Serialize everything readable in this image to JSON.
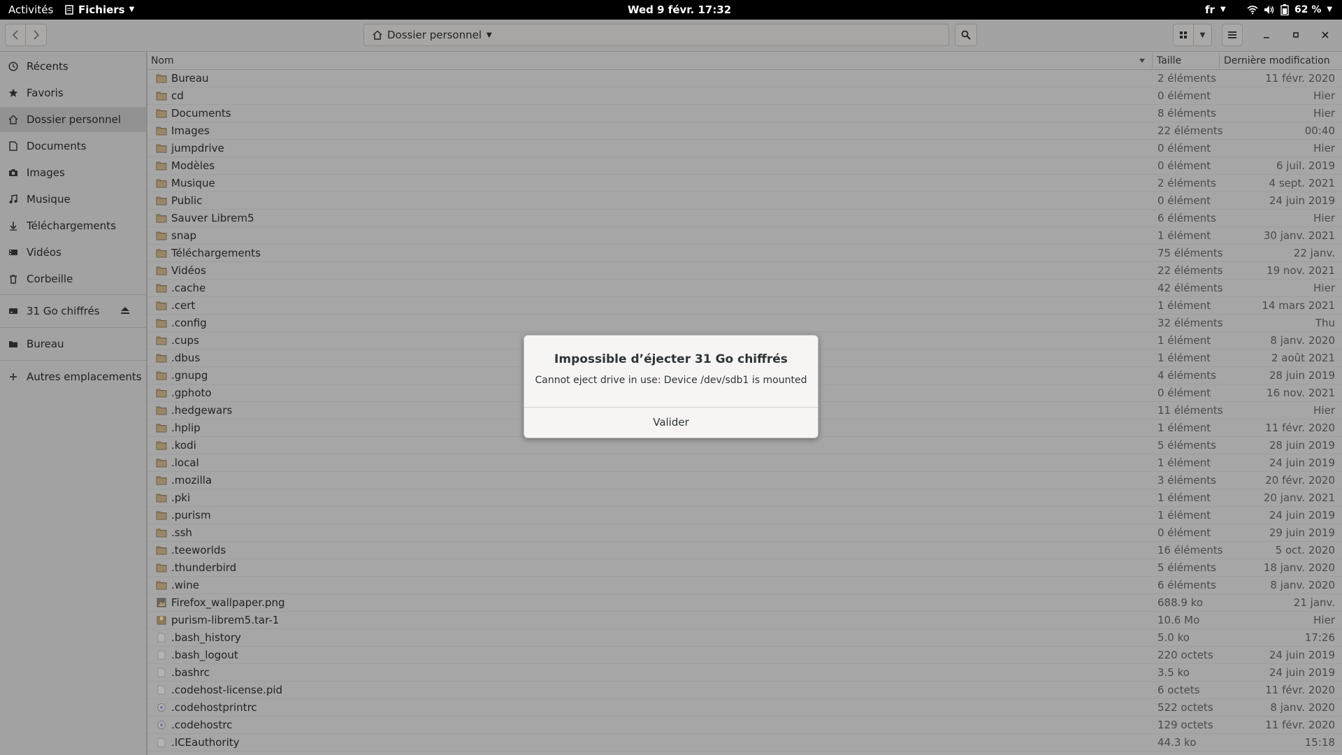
{
  "topbar": {
    "activities": "Activités",
    "app_menu": "Fichiers",
    "clock": "Wed 9 févr.  17:32",
    "language": "fr",
    "battery": "62 %"
  },
  "headerbar": {
    "location": "Dossier personnel"
  },
  "sidebar": {
    "items": [
      {
        "label": "Récents",
        "icon": "clock-icon"
      },
      {
        "label": "Favoris",
        "icon": "star-icon"
      },
      {
        "label": "Dossier personnel",
        "icon": "home-icon"
      },
      {
        "label": "Documents",
        "icon": "document-icon"
      },
      {
        "label": "Images",
        "icon": "camera-icon"
      },
      {
        "label": "Musique",
        "icon": "music-icon"
      },
      {
        "label": "Téléchargements",
        "icon": "download-icon"
      },
      {
        "label": "Vidéos",
        "icon": "video-icon"
      },
      {
        "label": "Corbeille",
        "icon": "trash-icon"
      }
    ],
    "drive": {
      "label": "31 Go chiffrés",
      "icon": "drive-icon"
    },
    "bookmark": {
      "label": "Bureau",
      "icon": "folder-icon"
    },
    "other": {
      "label": "Autres emplacements",
      "icon": "plus-icon"
    }
  },
  "columns": {
    "name": "Nom",
    "size": "Taille",
    "modified": "Dernière modification"
  },
  "files": [
    {
      "name": "Bureau",
      "size": "2 éléments",
      "modified": "11 févr. 2020",
      "type": "folder"
    },
    {
      "name": "cd",
      "size": "0 élément",
      "modified": "Hier",
      "type": "folder"
    },
    {
      "name": "Documents",
      "size": "8 éléments",
      "modified": "Hier",
      "type": "folder"
    },
    {
      "name": "Images",
      "size": "22 éléments",
      "modified": "00:40",
      "type": "folder"
    },
    {
      "name": "jumpdrive",
      "size": "0 élément",
      "modified": "Hier",
      "type": "folder"
    },
    {
      "name": "Modèles",
      "size": "0 élément",
      "modified": "6 juil. 2019",
      "type": "folder"
    },
    {
      "name": "Musique",
      "size": "2 éléments",
      "modified": "4 sept. 2021",
      "type": "folder"
    },
    {
      "name": "Public",
      "size": "0 élément",
      "modified": "24 juin 2019",
      "type": "folder"
    },
    {
      "name": "Sauver Librem5",
      "size": "6 éléments",
      "modified": "Hier",
      "type": "folder"
    },
    {
      "name": "snap",
      "size": "1 élément",
      "modified": "30 janv. 2021",
      "type": "folder"
    },
    {
      "name": "Téléchargements",
      "size": "75 éléments",
      "modified": "22 janv.",
      "type": "folder"
    },
    {
      "name": "Vidéos",
      "size": "22 éléments",
      "modified": "19 nov. 2021",
      "type": "folder"
    },
    {
      "name": ".cache",
      "size": "42 éléments",
      "modified": "Hier",
      "type": "folder"
    },
    {
      "name": ".cert",
      "size": "1 élément",
      "modified": "14 mars 2021",
      "type": "folder"
    },
    {
      "name": ".config",
      "size": "32 éléments",
      "modified": "Thu",
      "type": "folder"
    },
    {
      "name": ".cups",
      "size": "1 élément",
      "modified": "8 janv. 2020",
      "type": "folder"
    },
    {
      "name": ".dbus",
      "size": "1 élément",
      "modified": "2 août 2021",
      "type": "folder"
    },
    {
      "name": ".gnupg",
      "size": "4 éléments",
      "modified": "28 juin 2019",
      "type": "folder"
    },
    {
      "name": ".gphoto",
      "size": "0 élément",
      "modified": "16 nov. 2021",
      "type": "folder"
    },
    {
      "name": ".hedgewars",
      "size": "11 éléments",
      "modified": "Hier",
      "type": "folder"
    },
    {
      "name": ".hplip",
      "size": "1 élément",
      "modified": "11 févr. 2020",
      "type": "folder"
    },
    {
      "name": ".kodi",
      "size": "5 éléments",
      "modified": "28 juin 2019",
      "type": "folder"
    },
    {
      "name": ".local",
      "size": "1 élément",
      "modified": "24 juin 2019",
      "type": "folder"
    },
    {
      "name": ".mozilla",
      "size": "3 éléments",
      "modified": "20 févr. 2020",
      "type": "folder"
    },
    {
      "name": ".pki",
      "size": "1 élément",
      "modified": "20 janv. 2021",
      "type": "folder"
    },
    {
      "name": ".purism",
      "size": "1 élément",
      "modified": "24 juin 2019",
      "type": "folder"
    },
    {
      "name": ".ssh",
      "size": "0 élément",
      "modified": "29 juin 2019",
      "type": "folder"
    },
    {
      "name": ".teeworlds",
      "size": "16 éléments",
      "modified": "5 oct. 2020",
      "type": "folder"
    },
    {
      "name": ".thunderbird",
      "size": "5 éléments",
      "modified": "18 janv. 2020",
      "type": "folder"
    },
    {
      "name": ".wine",
      "size": "6 éléments",
      "modified": "8 janv. 2020",
      "type": "folder"
    },
    {
      "name": "Firefox_wallpaper.png",
      "size": "688.9 ko",
      "modified": "21 janv.",
      "type": "image"
    },
    {
      "name": "purism-librem5.tar-1",
      "size": "10.6 Mo",
      "modified": "Hier",
      "type": "archive"
    },
    {
      "name": ".bash_history",
      "size": "5.0 ko",
      "modified": "17:26",
      "type": "text"
    },
    {
      "name": ".bash_logout",
      "size": "220 octets",
      "modified": "24 juin 2019",
      "type": "text"
    },
    {
      "name": ".bashrc",
      "size": "3.5 ko",
      "modified": "24 juin 2019",
      "type": "text"
    },
    {
      "name": ".codehost-license.pid",
      "size": "6 octets",
      "modified": "11 févr. 2020",
      "type": "text"
    },
    {
      "name": ".codehostprintrc",
      "size": "522 octets",
      "modified": "8 janv. 2020",
      "type": "config"
    },
    {
      "name": ".codehostrc",
      "size": "129 octets",
      "modified": "11 févr. 2020",
      "type": "config"
    },
    {
      "name": ".ICEauthority",
      "size": "44.3 ko",
      "modified": "15:18",
      "type": "text"
    }
  ],
  "dialog": {
    "title": "Impossible d’éjecter 31 Go chiffrés",
    "message": "Cannot eject drive in use: Device /dev/sdb1 is mounted",
    "button": "Valider"
  },
  "colors": {
    "folder": "#8e7b5f",
    "overlay_panel": "#a2a2a2",
    "dialog_bg": "#f6f5f4"
  }
}
